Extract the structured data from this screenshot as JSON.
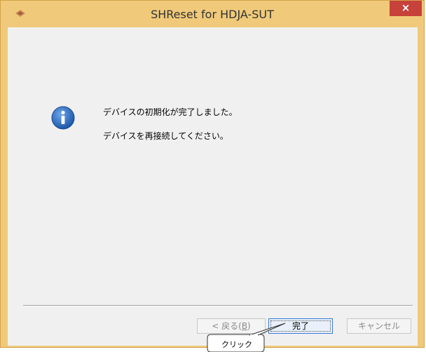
{
  "window": {
    "title": "SHReset for HDJA-SUT",
    "close_symbol": "×",
    "app_icon": "app-logo-icon",
    "close_icon": "close-icon"
  },
  "dialog": {
    "icon": "info-icon",
    "message_line1": "デバイスの初期化が完了しました。",
    "message_line2": "デバイスを再接続してください。"
  },
  "buttons": {
    "back_prefix": "< 戻る(",
    "back_key": "B",
    "back_suffix": ")",
    "finish": "完了",
    "cancel": "キャンセル"
  },
  "annotation": {
    "callout_text": "クリック"
  },
  "colors": {
    "frame": "#f0ca7a",
    "close_button": "#c7423a",
    "client": "#f0f0f0",
    "info_icon": "#2a66b8"
  }
}
